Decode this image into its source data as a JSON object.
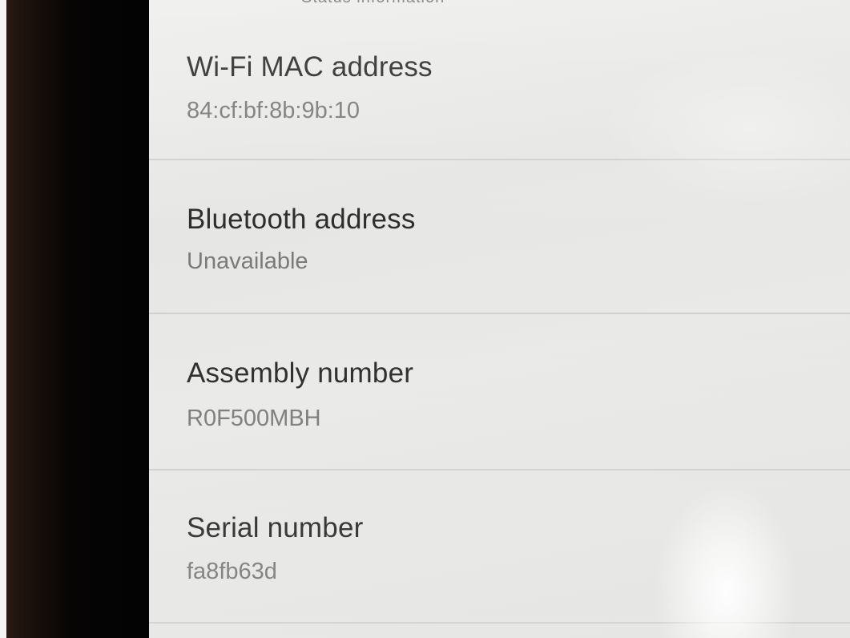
{
  "top_partial_text": "Status information",
  "items": [
    {
      "title": "Wi-Fi MAC address",
      "value": "84:cf:bf:8b:9b:10"
    },
    {
      "title": "Bluetooth address",
      "value": "Unavailable"
    },
    {
      "title": "Assembly number",
      "value": "R0F500MBH"
    },
    {
      "title": "Serial number",
      "value": "fa8fb63d"
    }
  ]
}
